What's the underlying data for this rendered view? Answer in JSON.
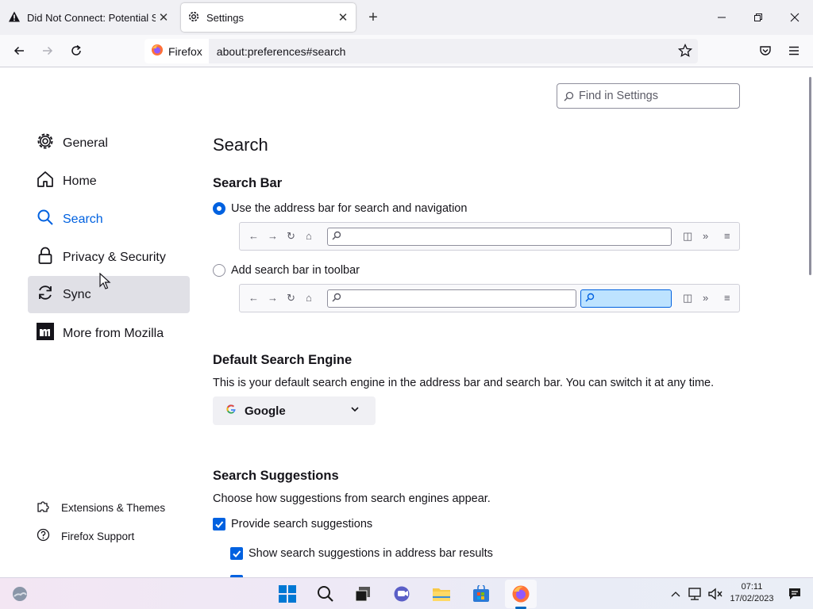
{
  "tabs": [
    {
      "label": "Did Not Connect: Potential Security Issue",
      "icon": "warning-icon"
    },
    {
      "label": "Settings",
      "icon": "gear-icon"
    }
  ],
  "toolbar": {
    "identity_label": "Firefox",
    "url": "about:preferences#search"
  },
  "find": {
    "placeholder": "Find in Settings"
  },
  "sidebar": {
    "categories": [
      {
        "label": "General",
        "icon": "gear-icon"
      },
      {
        "label": "Home",
        "icon": "home-icon"
      },
      {
        "label": "Search",
        "icon": "search-icon"
      },
      {
        "label": "Privacy & Security",
        "icon": "lock-icon"
      },
      {
        "label": "Sync",
        "icon": "sync-icon"
      },
      {
        "label": "More from Mozilla",
        "icon": "mozilla-icon"
      }
    ],
    "footer": [
      {
        "label": "Extensions & Themes",
        "icon": "puzzle-icon"
      },
      {
        "label": "Firefox Support",
        "icon": "help-icon"
      }
    ]
  },
  "main": {
    "title": "Search",
    "search_bar": {
      "heading": "Search Bar",
      "option_address": "Use the address bar for search and navigation",
      "option_toolbar": "Add search bar in toolbar",
      "selected": "address"
    },
    "default_engine": {
      "heading": "Default Search Engine",
      "description": "This is your default search engine in the address bar and search bar. You can switch it at any time.",
      "selected": "Google"
    },
    "suggestions": {
      "heading": "Search Suggestions",
      "description": "Choose how suggestions from search engines appear.",
      "provide": "Provide search suggestions",
      "show_in_address": "Show search suggestions in address bar results"
    }
  },
  "taskbar": {
    "time": "07:11",
    "date": "17/02/2023"
  },
  "colors": {
    "accent": "#0061e0",
    "tab_strip": "#f0f0f4"
  }
}
